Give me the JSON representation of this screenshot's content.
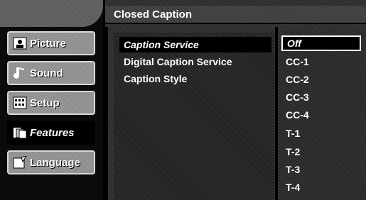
{
  "header": {
    "title": "Closed Caption"
  },
  "sidebar": {
    "items": [
      {
        "label": "Picture",
        "icon": "picture-icon",
        "active": false
      },
      {
        "label": "Sound",
        "icon": "sound-icon",
        "active": false
      },
      {
        "label": "Setup",
        "icon": "setup-icon",
        "active": false
      },
      {
        "label": "Features",
        "icon": "features-icon",
        "active": true
      },
      {
        "label": "Language",
        "icon": "language-icon",
        "active": false
      }
    ]
  },
  "menu": {
    "items": [
      {
        "label": "Caption Service",
        "active": true
      },
      {
        "label": "Digital Caption Service",
        "active": false
      },
      {
        "label": "Caption Style",
        "active": false
      }
    ]
  },
  "options": {
    "items": [
      "Off",
      "CC-1",
      "CC-2",
      "CC-3",
      "CC-4",
      "T-1",
      "T-2",
      "T-3",
      "T-4"
    ],
    "selected": "Off"
  }
}
